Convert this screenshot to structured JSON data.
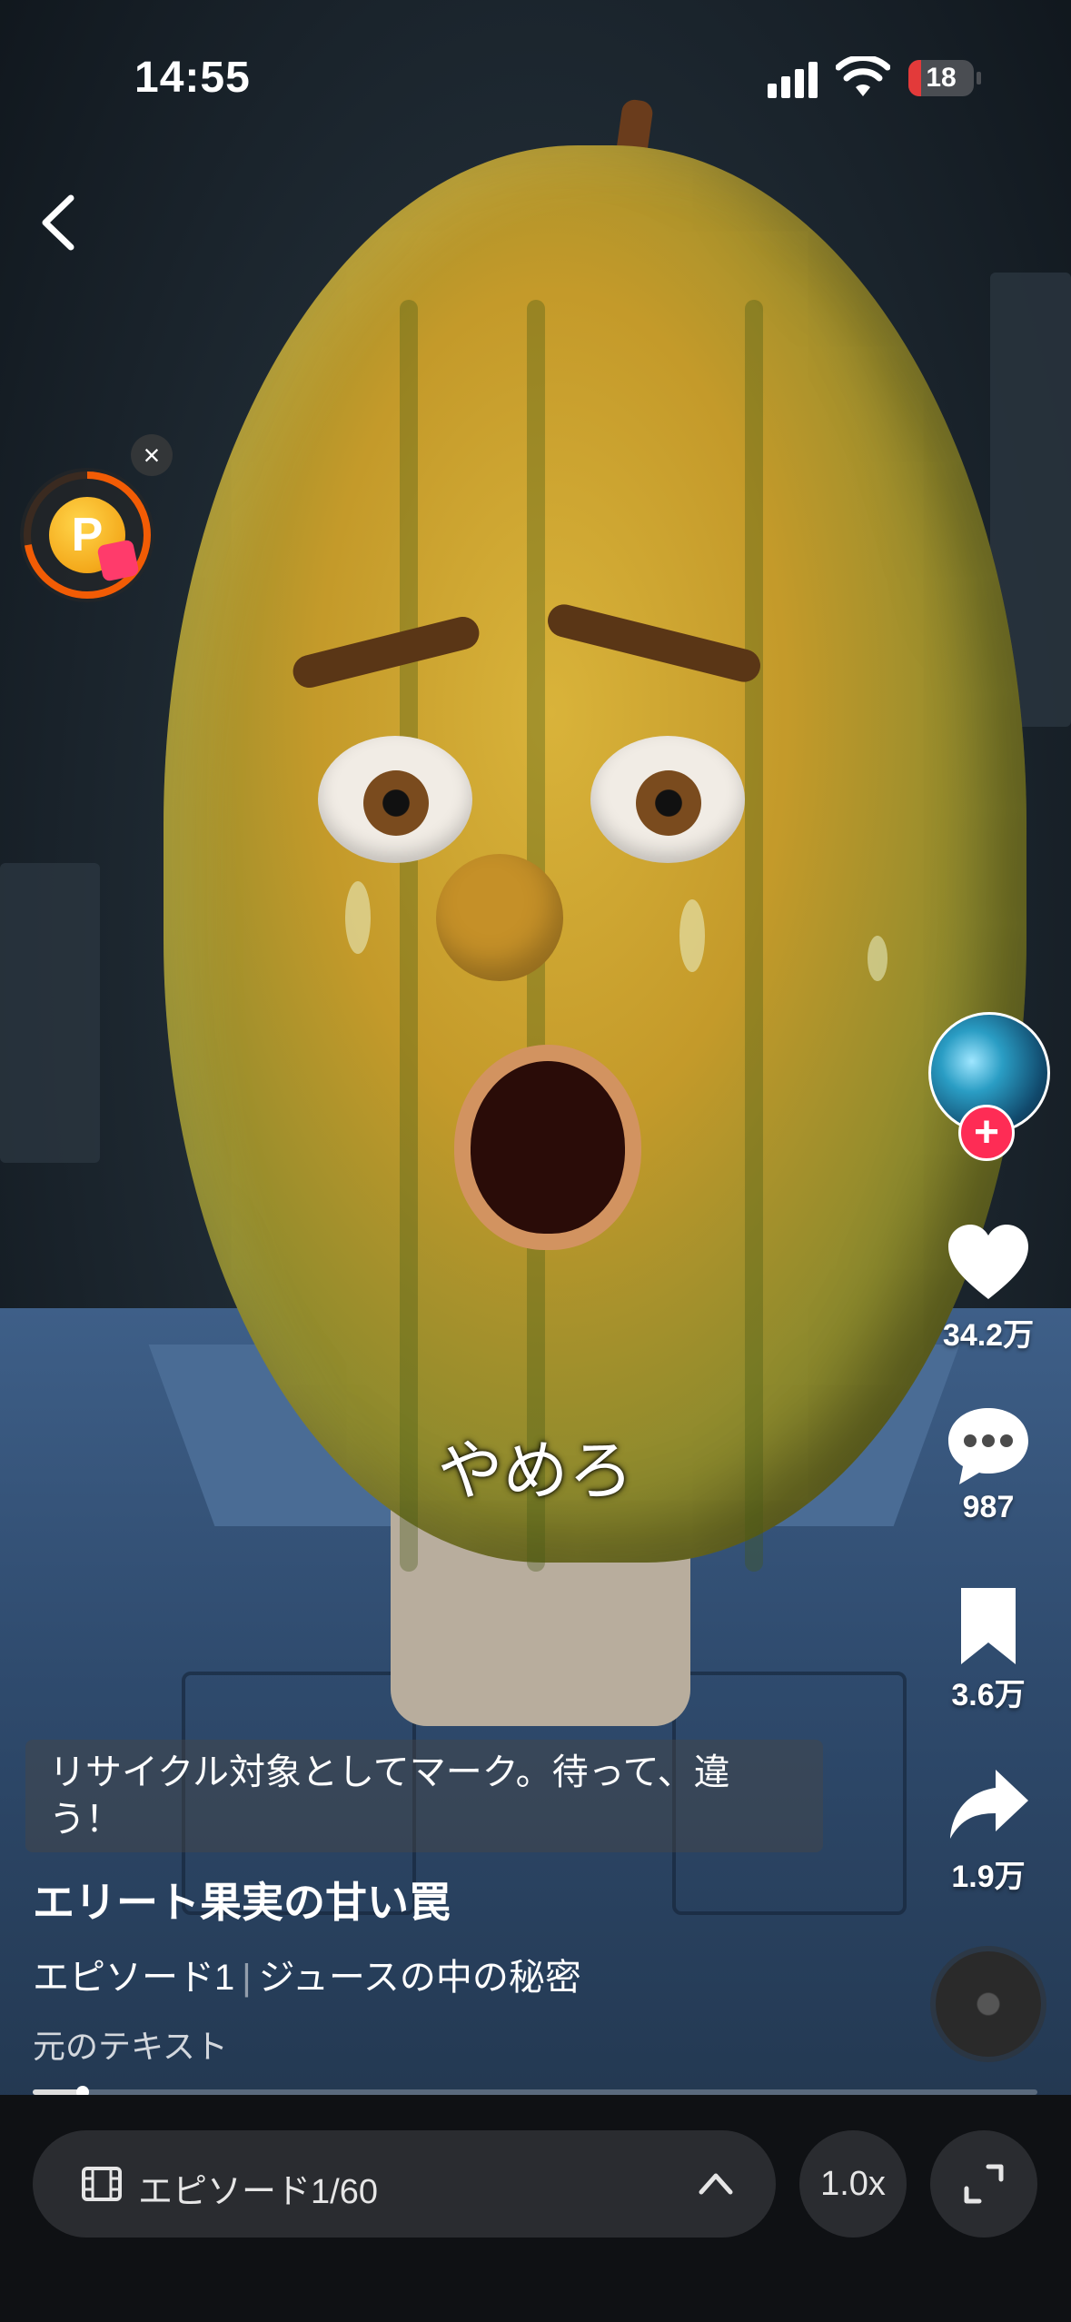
{
  "status_bar": {
    "time": "14:55",
    "battery": "18"
  },
  "video": {
    "subtitle": "やめろ",
    "caption": "リサイクル対象としてマーク。待って、違う！",
    "title": "エリート果実の甘い罠",
    "episode_label": "エピソード1",
    "episode_name": "ジュースの中の秘密",
    "original_text": "元のテキスト",
    "progress_fraction": 0.05
  },
  "actions": {
    "likes": "34.2万",
    "comments": "987",
    "saves": "3.6万",
    "shares": "1.9万"
  },
  "bottom_bar": {
    "episodes": "エピソード1/60",
    "speed": "1.0x"
  },
  "icons": {
    "back": "chevron-left-icon",
    "points": "coin-p-icon",
    "like": "heart-icon",
    "comment": "chat-bubble-icon",
    "save": "bookmark-icon",
    "share": "share-arrow-icon",
    "episodes": "film-icon",
    "expand": "chevron-up-icon",
    "fullscreen": "fullscreen-icon"
  },
  "colors": {
    "follow": "#fe2c55",
    "battery_low": "#e33a3a",
    "points_ring": "#f25c05"
  }
}
